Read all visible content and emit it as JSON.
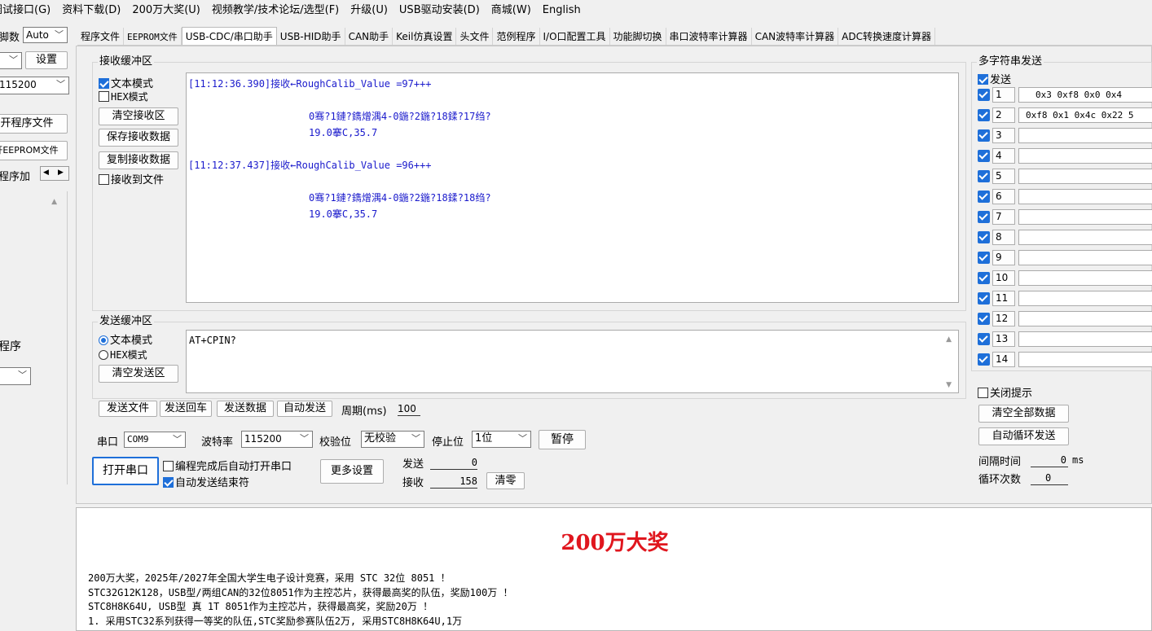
{
  "menu": [
    "调试接口(G)",
    "资料下载(D)",
    "200万大奖(U)",
    "视频教学/技术论坛/选型(F)",
    "升级(U)",
    "USB驱动安装(D)",
    "商城(W)",
    "English"
  ],
  "left": {
    "pin_label": "脚数",
    "pin_value": "Auto",
    "port_value": "",
    "settings_button": "设置",
    "baud_value": "115200",
    "open_program_file": "打开程序文件",
    "open_eeprom_file": "打开EEPROM文件",
    "program_add_label": "程序加",
    "download_label": "程序",
    "bottom_select": ""
  },
  "tabs": [
    "程序文件",
    "EEPROM文件",
    "USB-CDC/串口助手",
    "USB-HID助手",
    "CAN助手",
    "Keil仿真设置",
    "头文件",
    "范例程序",
    "I/O口配置工具",
    "功能脚切换",
    "串口波特率计算器",
    "CAN波特率计算器",
    "ADC转换速度计算器"
  ],
  "receive": {
    "group_label": "接收缓冲区",
    "text_mode": "文本模式",
    "hex_mode": "HEX模式",
    "clear": "清空接收区",
    "save": "保存接收数据",
    "copy": "复制接收数据",
    "to_file": "接收到文件",
    "lines": [
      "[11:12:36.390]接收←RoughCalib_Value =97+++",
      "0骞?1鏈?鐫熷湡4-0鍦?2鍦?18鍒?17绉?",
      "19.0搴C,35.7",
      "[11:12:37.437]接收←RoughCalib_Value =96+++",
      "0骞?1鏈?鐫熷湡4-0鍦?2鍦?18鍒?18绉?",
      "19.0搴C,35.7"
    ]
  },
  "send": {
    "group_label": "发送缓冲区",
    "text_mode": "文本模式",
    "hex_mode": "HEX模式",
    "clear": "清空发送区",
    "content": "AT+CPIN?",
    "send_file": "发送文件",
    "send_enter": "发送回车",
    "send_data": "发送数据",
    "auto_send": "自动发送",
    "period_label": "周期(ms)",
    "period_value": "100"
  },
  "serial": {
    "port_label": "串口",
    "port_value": "COM9",
    "baud_label": "波特率",
    "baud_value": "115200",
    "parity_label": "校验位",
    "parity_value": "无校验",
    "stop_label": "停止位",
    "stop_value": "1位",
    "pause": "暂停",
    "open_port": "打开串口",
    "auto_open": "编程完成后自动打开串口",
    "auto_end": "自动发送结束符",
    "more_settings": "更多设置",
    "send_label": "发送",
    "send_count": "0",
    "recv_label": "接收",
    "recv_count": "158",
    "clear_counts": "清零"
  },
  "multi": {
    "title": "多字符串发送",
    "send_label": "发送",
    "rows": [
      {
        "n": "1",
        "v": "0x3 0xf8 0x0 0x4"
      },
      {
        "n": "2",
        "v": "0xf8 0x1 0x4c 0x22  5"
      },
      {
        "n": "3",
        "v": ""
      },
      {
        "n": "4",
        "v": ""
      },
      {
        "n": "5",
        "v": ""
      },
      {
        "n": "6",
        "v": ""
      },
      {
        "n": "7",
        "v": ""
      },
      {
        "n": "8",
        "v": ""
      },
      {
        "n": "9",
        "v": ""
      },
      {
        "n": "10",
        "v": ""
      },
      {
        "n": "11",
        "v": ""
      },
      {
        "n": "12",
        "v": ""
      },
      {
        "n": "13",
        "v": ""
      },
      {
        "n": "14",
        "v": ""
      }
    ],
    "close_tip": "关闭提示",
    "clear_all": "清空全部数据",
    "auto_loop": "自动循环发送",
    "interval_label": "间隔时间",
    "interval_value": "0",
    "interval_unit": "ms",
    "loop_label": "循环次数",
    "loop_value": "0"
  },
  "info": {
    "title": "200万大奖",
    "lines": [
      "200万大奖，2025年/2027年全国大学生电子设计竞赛，采用 STC 32位 8051 ！",
      "STC32G12K128，USB型/两组CAN的32位8051作为主控芯片，获得最高奖的队伍，奖励100万 ！",
      "STC8H8K64U, USB型 真 1T 8051作为主控芯片，获得最高奖，奖励20万 ！",
      "1. 采用STC32系列获得一等奖的队伍,STC奖励参赛队伍2万, 采用STC8H8K64U,1万"
    ],
    "title_color": "#e0161e"
  },
  "colors": {
    "accent": "#1e6fd9",
    "recv_text": "#1a1acc"
  }
}
